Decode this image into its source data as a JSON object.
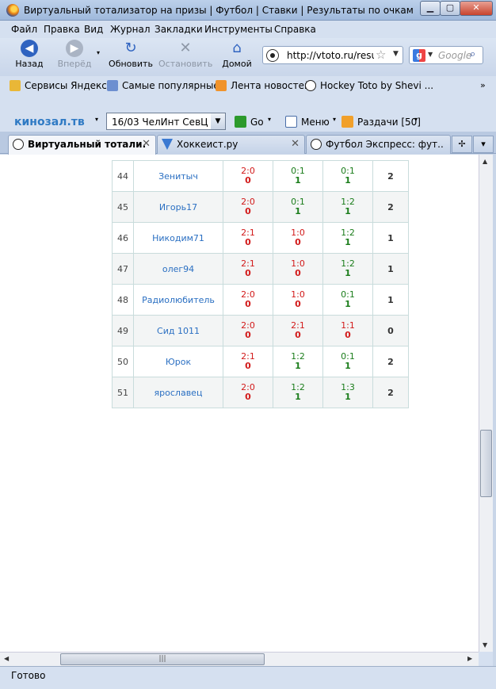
{
  "window": {
    "title": "Виртуальный тотализатор на призы | Футбол | Ставки | Результаты по очкам ЛИГА ЖИВ...",
    "min_icon": "minimize-icon",
    "max_icon": "maximize-icon",
    "close_icon": "close-icon"
  },
  "menu": [
    "Файл",
    "Правка",
    "Вид",
    "Журнал",
    "Закладки",
    "Инструменты",
    "Справка"
  ],
  "nav": {
    "back": "Назад",
    "forward": "Вперёд",
    "reload": "Обновить",
    "stop": "Остановить",
    "home": "Домой",
    "url": "http://vtoto.ru/resu",
    "search_placeholder": "Google"
  },
  "bookmarks": [
    "Сервисы Яндекса",
    "Самые популярные",
    "Лента новостей",
    "Hockey Toto by Shevi ..."
  ],
  "toolbar2": {
    "brand": "кинозал.тв",
    "select_value": "16/03    ЧелИнт  СевЦ",
    "go": "Go",
    "menu": "Меню",
    "razdachi": "Раздачи [50]"
  },
  "tabs": [
    {
      "label": "Виртуальный тотали...",
      "active": true
    },
    {
      "label": "Хоккеист.ру",
      "active": false
    },
    {
      "label": "Футбол Экспресс: фут...",
      "active": false
    }
  ],
  "rows": [
    {
      "num": "44",
      "name": "Зенитыч",
      "b1": [
        "2:0",
        "0"
      ],
      "b1c": "r",
      "b2": [
        "0:1",
        "1"
      ],
      "b2c": "g",
      "b3": [
        "0:1",
        "1"
      ],
      "b3c": "g",
      "sum": "2"
    },
    {
      "num": "45",
      "name": "Игорь17",
      "b1": [
        "2:0",
        "0"
      ],
      "b1c": "r",
      "b2": [
        "0:1",
        "1"
      ],
      "b2c": "g",
      "b3": [
        "1:2",
        "1"
      ],
      "b3c": "g",
      "sum": "2"
    },
    {
      "num": "46",
      "name": "Никодим71",
      "b1": [
        "2:1",
        "0"
      ],
      "b1c": "r",
      "b2": [
        "1:0",
        "0"
      ],
      "b2c": "r",
      "b3": [
        "1:2",
        "1"
      ],
      "b3c": "g",
      "sum": "1"
    },
    {
      "num": "47",
      "name": "олег94",
      "b1": [
        "2:1",
        "0"
      ],
      "b1c": "r",
      "b2": [
        "1:0",
        "0"
      ],
      "b2c": "r",
      "b3": [
        "1:2",
        "1"
      ],
      "b3c": "g",
      "sum": "1"
    },
    {
      "num": "48",
      "name": "Радиолюбитель",
      "b1": [
        "2:0",
        "0"
      ],
      "b1c": "r",
      "b2": [
        "1:0",
        "0"
      ],
      "b2c": "r",
      "b3": [
        "0:1",
        "1"
      ],
      "b3c": "g",
      "sum": "1"
    },
    {
      "num": "49",
      "name": "Сид 1011",
      "b1": [
        "2:0",
        "0"
      ],
      "b1c": "r",
      "b2": [
        "2:1",
        "0"
      ],
      "b2c": "r",
      "b3": [
        "1:1",
        "0"
      ],
      "b3c": "r",
      "sum": "0"
    },
    {
      "num": "50",
      "name": "Юрок",
      "b1": [
        "2:1",
        "0"
      ],
      "b1c": "r",
      "b2": [
        "1:2",
        "1"
      ],
      "b2c": "g",
      "b3": [
        "0:1",
        "1"
      ],
      "b3c": "g",
      "sum": "2"
    },
    {
      "num": "51",
      "name": "ярославец",
      "b1": [
        "2:0",
        "0"
      ],
      "b1c": "r",
      "b2": [
        "1:2",
        "1"
      ],
      "b2c": "g",
      "b3": [
        "1:3",
        "1"
      ],
      "b3c": "g",
      "sum": "2"
    }
  ],
  "status": "Готово"
}
